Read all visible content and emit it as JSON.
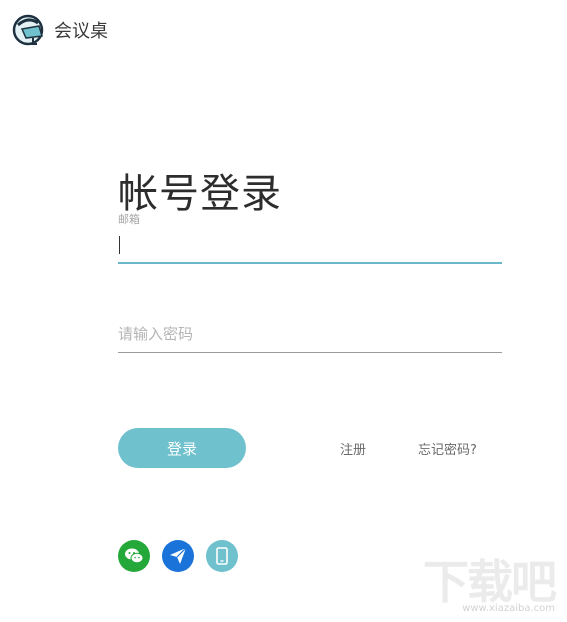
{
  "app": {
    "name": "会议桌"
  },
  "login": {
    "title": "帐号登录",
    "email_label": "邮箱",
    "email_value": "",
    "password_placeholder": "请输入密码",
    "login_button": "登录",
    "register_link": "注册",
    "forgot_link": "忘记密码?"
  },
  "social": [
    {
      "name": "wechat-icon",
      "color": "#25a83a"
    },
    {
      "name": "send-icon",
      "color": "#1a73d8"
    },
    {
      "name": "mobile-icon",
      "color": "#6ec1cd"
    }
  ],
  "watermark": {
    "mark": "下载吧",
    "url": "www.xiazaiba.com"
  },
  "colors": {
    "accent": "#6ec1cd",
    "focus_underline": "#69b7c9"
  }
}
